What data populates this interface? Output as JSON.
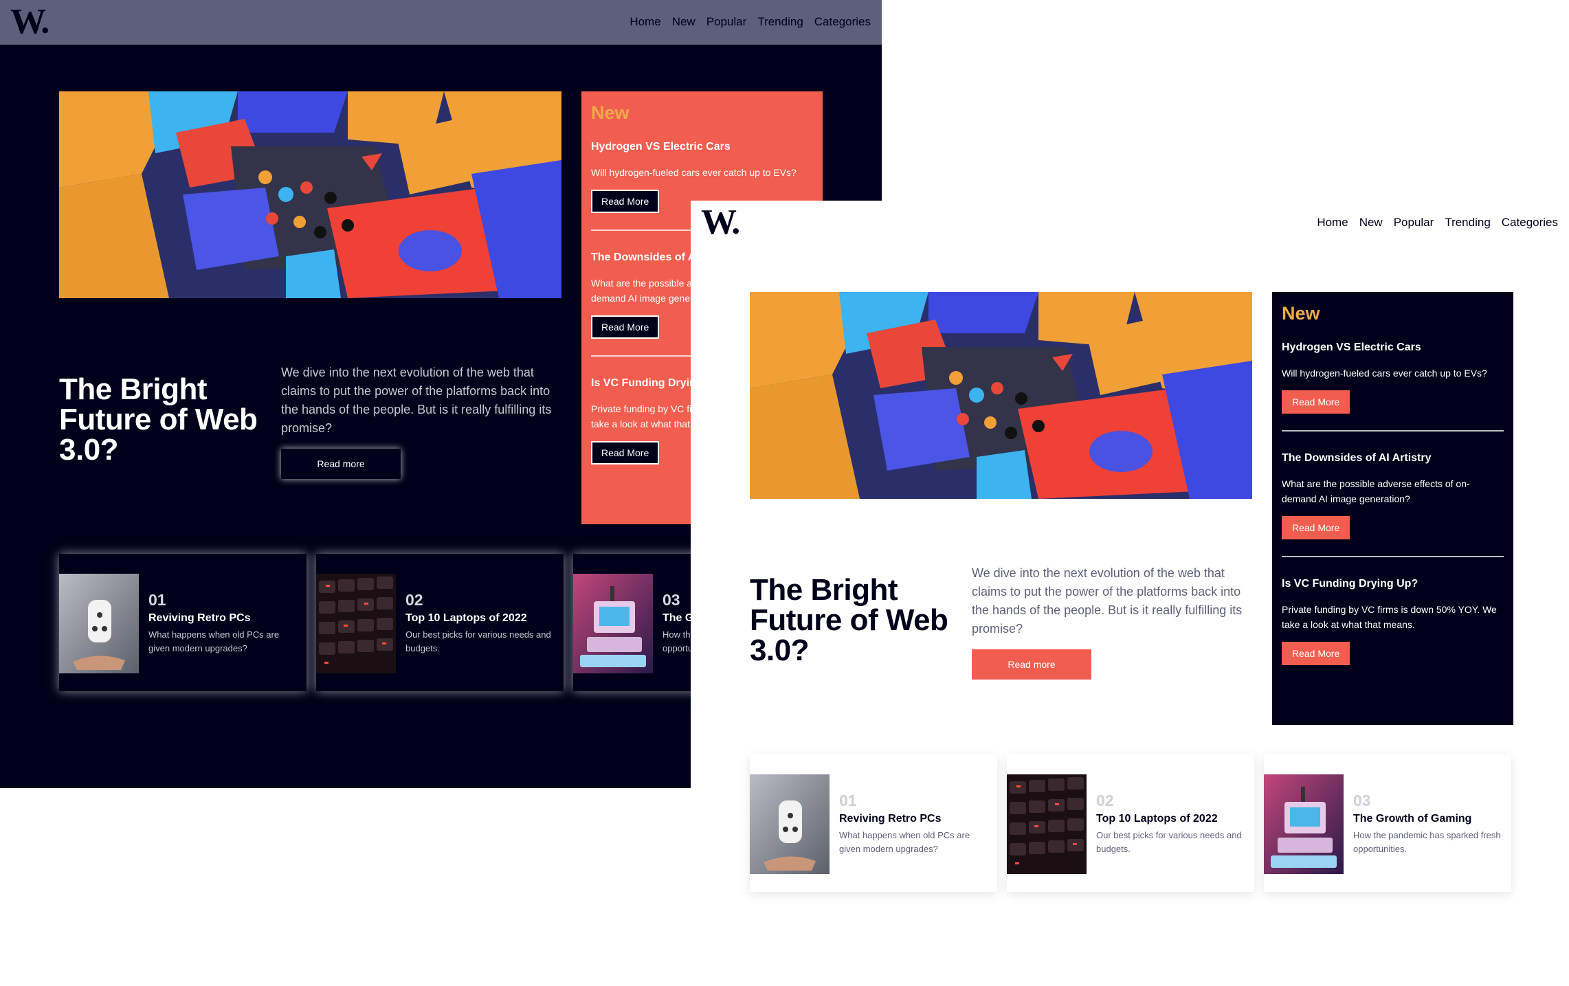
{
  "brand": {
    "logo": "W."
  },
  "colors": {
    "navy": "#00001a",
    "coral": "#f15e50",
    "amber": "#f0a94a",
    "slate": "#5e6079"
  },
  "nav": [
    "Home",
    "New",
    "Popular",
    "Trending",
    "Categories"
  ],
  "hero": {
    "headline": "The Bright Future of Web 3.0?",
    "summary": "We dive into the next evolution of the web that claims to put the power of the platforms back into the hands of the people. But is it really fulfilling its promise?",
    "dark_button": "Read more",
    "light_button": "Read more"
  },
  "new_panel": {
    "heading": "New",
    "items": [
      {
        "title": "Hydrogen VS Electric Cars",
        "desc": "Will hydrogen-fueled cars ever catch up to EVs?",
        "button": "Read More"
      },
      {
        "title": "The Downsides of AI Artistry",
        "desc": "What are the possible adverse effects of on-demand AI image generation?",
        "button": "Read More"
      },
      {
        "title": "Is VC Funding Drying Up?",
        "desc": "Private funding by VC firms is down 50% YOY. We take a look at what that means.",
        "button": "Read More"
      }
    ]
  },
  "cards": [
    {
      "num": "01",
      "title": "Reviving Retro PCs",
      "desc": "What happens when old PCs are given modern upgrades?",
      "icon": "game-controller-image"
    },
    {
      "num": "02",
      "title": "Top 10 Laptops of 2022",
      "desc": "Our best picks for various needs and budgets.",
      "icon": "keyboard-image"
    },
    {
      "num": "03",
      "title": "The Growth of Gaming",
      "desc": "How the pandemic has sparked fresh opportunities.",
      "icon": "retro-computer-image"
    }
  ]
}
